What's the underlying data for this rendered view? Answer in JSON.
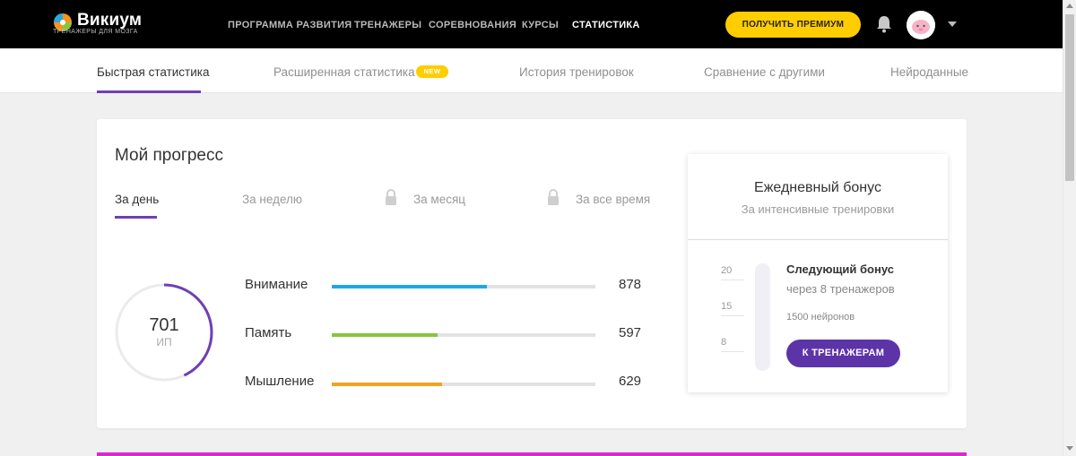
{
  "brand": {
    "name": "Викиум",
    "tagline": "ТРЕНАЖЕРЫ ДЛЯ МОЗГА"
  },
  "nav": {
    "items": [
      {
        "label": "ПРОГРАММА РАЗВИТИЯ"
      },
      {
        "label": "ТРЕНАЖЕРЫ"
      },
      {
        "label": "СОРЕВНОВАНИЯ"
      },
      {
        "label": "КУРСЫ"
      },
      {
        "label": "СТАТИСТИКА",
        "active": true
      }
    ],
    "premium_label": "ПОЛУЧИТЬ ПРЕМИУМ",
    "bell_icon": "bell-icon",
    "avatar_icon": "avatar-icon"
  },
  "tabs": [
    {
      "label": "Быстрая статистика",
      "active": true
    },
    {
      "label": "Расширенная статистика",
      "badge": "NEW"
    },
    {
      "label": "История тренировок"
    },
    {
      "label": "Сравнение с другими"
    },
    {
      "label": "Нейроданные"
    }
  ],
  "progress": {
    "title": "Мой прогресс",
    "periods": [
      {
        "label": "За день",
        "active": true,
        "locked": false
      },
      {
        "label": "За неделю",
        "locked": false
      },
      {
        "label": "За месяц",
        "locked": true
      },
      {
        "label": "За все время",
        "locked": true
      }
    ],
    "score": {
      "value": "701",
      "unit": "ИП",
      "ring_fraction": 0.43
    },
    "skills": [
      {
        "label": "Внимание",
        "value": "878",
        "fraction": 0.59,
        "color": "#1ea7e8"
      },
      {
        "label": "Память",
        "value": "597",
        "fraction": 0.4,
        "color": "#86c63b"
      },
      {
        "label": "Мышление",
        "value": "629",
        "fraction": 0.42,
        "color": "#f0a31f"
      }
    ]
  },
  "bonus": {
    "title": "Ежедневный бонус",
    "subtitle": "За интенсивные тренировки",
    "scale": [
      "20",
      "15",
      "8"
    ],
    "next_title": "Следующий бонус",
    "next_subtitle": "через 8 тренажеров",
    "reward": "1500 нейронов",
    "button_label": "К ТРЕНАЖЕРАМ"
  },
  "colors": {
    "accent": "#6f3fb5",
    "premium": "#ffcd00",
    "button": "#5c34a8"
  }
}
